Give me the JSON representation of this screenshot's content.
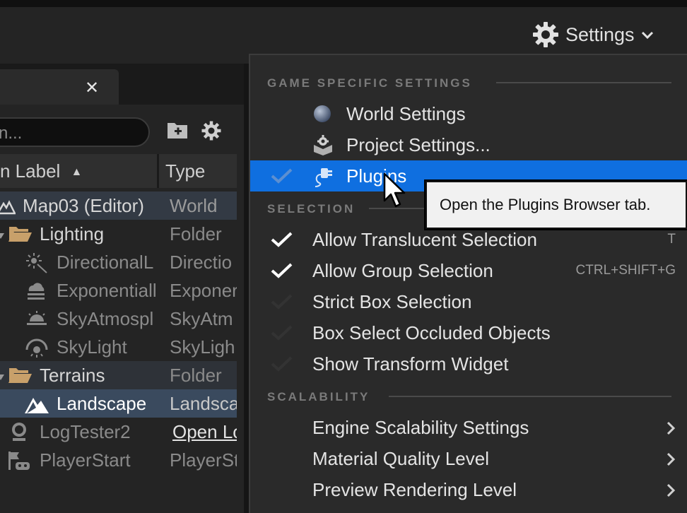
{
  "toolbar": {
    "settings_label": "Settings"
  },
  "outliner": {
    "search_placeholder": "n...",
    "columns": {
      "label": "n Label",
      "sort_indicator": "▲",
      "type": "Type"
    },
    "rows": [
      {
        "label": "Map03 (Editor)",
        "type": "World"
      },
      {
        "label": "Lighting",
        "type": "Folder"
      },
      {
        "label": "DirectionalL",
        "type": "Directio"
      },
      {
        "label": "Exponentiall",
        "type": "Exponer"
      },
      {
        "label": "SkyAtmospl",
        "type": "SkyAtm"
      },
      {
        "label": "SkyLight",
        "type": "SkyLigh"
      },
      {
        "label": "Terrains",
        "type": "Folder"
      },
      {
        "label": "Landscape",
        "type": "Landsca"
      },
      {
        "label": "LogTester2",
        "type": "Open Lo"
      },
      {
        "label": "PlayerStart",
        "type": "PlayerSt"
      }
    ]
  },
  "menu": {
    "sections": {
      "game": "GAME SPECIFIC SETTINGS",
      "selection": "SELECTION",
      "scalability": "SCALABILITY"
    },
    "game_items": [
      {
        "label": "World Settings"
      },
      {
        "label": "Project Settings..."
      },
      {
        "label": "Plugins"
      }
    ],
    "selection_items": [
      {
        "label": "Allow Translucent Selection",
        "shortcut": "T",
        "checked": true
      },
      {
        "label": "Allow Group Selection",
        "shortcut": "CTRL+SHIFT+G",
        "checked": true
      },
      {
        "label": "Strict Box Selection",
        "shortcut": "",
        "checked": false
      },
      {
        "label": "Box Select Occluded Objects",
        "shortcut": "",
        "checked": false
      },
      {
        "label": "Show Transform Widget",
        "shortcut": "",
        "checked": false
      }
    ],
    "scalability_items": [
      {
        "label": "Engine Scalability Settings"
      },
      {
        "label": "Material Quality Level"
      },
      {
        "label": "Preview Rendering Level"
      }
    ]
  },
  "tooltip": {
    "text": "Open the Plugins Browser tab."
  },
  "colors": {
    "highlight": "#0f6fe0",
    "selected_row": "#3a4a5e",
    "folder": "#c8a06a"
  }
}
